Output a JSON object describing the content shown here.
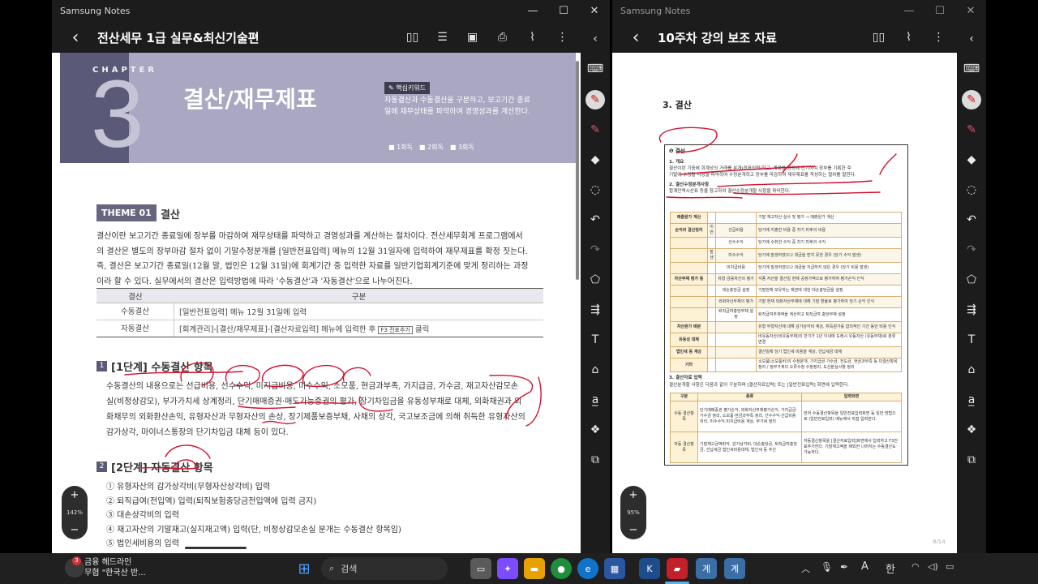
{
  "left_window": {
    "app_title": "Samsung Notes",
    "doc_title": "전산세무 1급 실무&최신기술편",
    "zoom": "142%",
    "chapter_label": "CHAPTER",
    "chapter_number": "3",
    "chapter_title": "결산/재무제표",
    "keyword_badge": "✎ 핵심키워드",
    "keyword_text_1": "자동결산과 수동결산을 구분하고, 보고기간 종료",
    "keyword_text_2": "일에 재무상태를 파악하여 경영성과를 계산한다.",
    "reading_checks": [
      "1회독",
      "2회독",
      "3회독"
    ],
    "theme_badge": "THEME 01",
    "theme_title": "결산",
    "body_lines": [
      "결산이란 보고기간 종료일에 장부를 마감하여 재무상태를 파악하고 경영성과를 계산하는 절차이다. 전산세무회계 프로그램에서",
      "의 결산은 별도의 장부마감 절차 없이 기말수정분개를 [일반전표입력] 메뉴의 12월 31일자에 입력하여 재무제표를 확정 짓는다.",
      "즉, 결산은 보고기간 종료일(12월 말, 법인은 12월 31일)에 회계기간 중 입력한 자료를 일반기업회계기준에 맞게 정리하는 과정",
      "이라 할 수 있다. 실무에서의 결산은 입력방법에 따라 '수동결산'과 '자동결산'으로 나누어진다."
    ],
    "table_headers": [
      "결산",
      "구분"
    ],
    "table_rows": [
      {
        "type": "수동결산",
        "desc": "[일반전표입력] 메뉴 12월 31일에 입력"
      },
      {
        "type": "자동결산",
        "desc": "[회계관리]-[결산/재무제표]-[결산자료입력] 메뉴에 입력한 후",
        "key": "F3 전표추가",
        "after": "클릭"
      }
    ],
    "section1_num": "1",
    "section1_title": "[1단계] 수동결산 항목",
    "section1_lines": [
      "수동결산의 내용으로는 선급비용, 선수수익, 미지급비용, 미수수익, 소모품, 현금과부족, 가지급금, 가수금, 재고자산감모손",
      "실(비정상감모), 부가가치세 상계정리, 단기매매증권·매도가능증권의 평가, 장기차입금을 유동성부채로 대체, 외화채권과 외",
      "화채무의 외화환산손익, 유형자산과 무형자산의 손상, 장기제품보증부채, 사채의 상각, 국고보조금에 의해 취득한 유형자산의",
      "감가상각, 마이너스통장의 단기차입금 대체 등이 있다."
    ],
    "section2_num": "2",
    "section2_title": "[2단계] 자동결산 항목",
    "section2_items": [
      "① 유형자산의 감가상각비(무형자산상각비) 입력",
      "② 퇴직급여(전입액) 입력(퇴직보험충당금전입액에 입력 금지)",
      "③ 대손상각비의 입력",
      "④ 재고자산의 기말재고(실지재고액) 입력(단, 비정상감모손실 분개는 수동결산 항목임)",
      "⑤ 법인세비용의 입력"
    ]
  },
  "right_window": {
    "app_title": "Samsung Notes",
    "doc_title": "10주차 강의 보조 자료",
    "zoom": "95%",
    "page_indicator": "8/14",
    "heading": "3. 결산",
    "box_title": "❶ 결산",
    "sub1": "1. 개요",
    "overview_1": "결산이란 기중에 회계상의 거래를 분개(전표입력)하고, 계정별 원장에 전기하여 장부를 기록한 후",
    "overview_2": "기말에 수정할 사항을 파악하여 수정분개하고 장부를 마감하여 재무제표를 작성하는 절차를 말한다.",
    "sub2": "2. 결산수정분개사항",
    "sub2_desc": "합계잔액시산표 등을 참고하여 결산수정분개할 사항을 파악한다.",
    "adj_rows": [
      {
        "cat": "매출원가 계산",
        "sub": "",
        "item": "",
        "desc": "기말 재고자산 실사 및 평가 → 매출원가 계산"
      },
      {
        "cat": "손익의 결산정리",
        "sub": "이연",
        "item": "선급비용",
        "desc": "당기에 지출한 비용 중 차기 미후의 비용"
      },
      {
        "cat": "",
        "sub": "",
        "item": "선수수익",
        "desc": "당기에 수취한 수익 중 차기 미후의 수익"
      },
      {
        "cat": "",
        "sub": "발생",
        "item": "미수수익",
        "desc": "당기에 발생하였으나 대금을 받지 못한 경우 (당기 수익 발생)"
      },
      {
        "cat": "",
        "sub": "",
        "item": "미지급비용",
        "desc": "당기에 발생하였으나 대금을 지급하지 않은 경우 (당기 비용 발생)"
      },
      {
        "cat": "자산부채 평가 등",
        "sub": "",
        "item": "유형·금융자산의 평가",
        "desc": "각종 자산을 결산일 현재 공정가액으로 평가하여 평가손익 인식"
      },
      {
        "cat": "",
        "sub": "",
        "item": "대손충당금 설정",
        "desc": "기말현재 보유하는 채권에 대한 대손충당금을 설정"
      },
      {
        "cat": "",
        "sub": "",
        "item": "외화자산부채의 평가",
        "desc": "기말 현재 외화자산부채에 대해 기말 환율로 평가하여 당기 손익 인식"
      },
      {
        "cat": "",
        "sub": "",
        "item": "퇴직급여충당부채 설정",
        "desc": "퇴직급여추계액을 계산하고 퇴직급여 충당부채 설정"
      },
      {
        "cat": "자산원가 배분",
        "sub": "",
        "item": "",
        "desc": "유형 무형자산에 대해 감가상각비 계상, 취득원가를 합리적인 기간 동안 비용 인식"
      },
      {
        "cat": "유동성 대체",
        "sub": "",
        "item": "",
        "desc": "비유동자산(비유동부채)의 만기가 1년 이내에 도래시 유동자산 (유동부채)로 분류 변경"
      },
      {
        "cat": "법인세 등 계상",
        "sub": "",
        "item": "",
        "desc": "결산일에 당기 법인세 비용을 계상, 선납세금 대체"
      },
      {
        "cat": "기타",
        "sub": "",
        "item": "",
        "desc": "소모품(소모품비)의 수정분개, 가지급금·가수금, 전도금, 현금과부족 등 미결산항목 정리 / 정부가계의 오류수정 수정정리, 도산분실사항 정리"
      }
    ],
    "sub3": "3. 결산자료 입력",
    "sub3_desc": "결산분개할 사항은 다음과 같이 구분하며 [결산자료입력] 또는 [일반전표입력] 화면에 입력한다.",
    "input_headers": [
      "구분",
      "종류",
      "입력화면"
    ],
    "input_rows": [
      {
        "kind": "수동 결산항목",
        "types": "단기매매증권 평가손익, 외화자산부채평가손익, 가지급금·가수금 정리, 소모품·현금과부족 정리, 선수수익·선급비용 처리, 미수수익·미지급비용 계상, 부가세 정리",
        "screen": "먼저 수동결산항목을 일반전표입력화면 등 일반 방법으로 (일반전표입력) 메뉴에서 직접 입력한다."
      },
      {
        "kind": "자동 결산항목",
        "types": "기말재고금액파악, 감가상각비, 대손충당금, 퇴직급여충당금, 선납세금 법인세비용대체, 법인세 등 추산",
        "screen": "자동결산항목을 [결산자료입력]화면에서 입력하고 F3전표추가한다. 기말재고액을 제외한 나머지는 수동결산도 가능하다."
      }
    ]
  },
  "taskbar": {
    "news_title": "금융 헤드라인",
    "news_sub": "무협 \"한국산 반...",
    "news_badge": "3",
    "search_label": "검색",
    "ime_label": "한",
    "lang_label": "A",
    "time": "",
    "accent": "#0078d4"
  }
}
